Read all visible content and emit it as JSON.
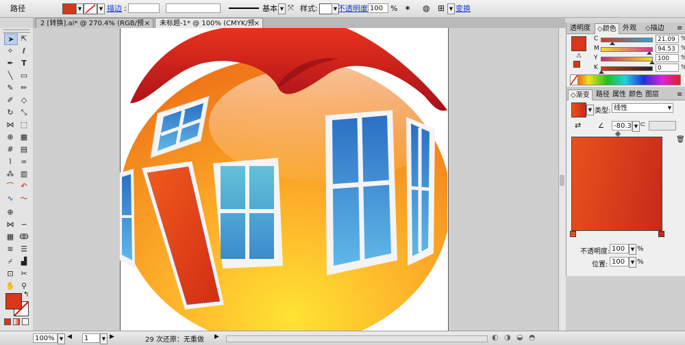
{
  "control_bar": {
    "object_type": "路径",
    "fill_color": "#d9371a",
    "stroke_label": "描边",
    "stroke_weight": "",
    "brush_profile": "基本",
    "style_label": "样式:",
    "opacity_label": "不透明度",
    "opacity_value": "100",
    "opacity_unit": "%",
    "transform_label": "变换"
  },
  "document_tabs": [
    {
      "label": "2 [转换].ai* @ 270.4% (RGB/预览)",
      "close": "×"
    },
    {
      "label": "未标题-1* @ 100% (CMYK/预览)",
      "close": "×"
    }
  ],
  "panels": {
    "top_tabs": [
      "透明度",
      "颜色",
      "外观",
      "描边"
    ],
    "color": {
      "swatch": "#d9371a",
      "channels": [
        {
          "name": "C",
          "value": "21.09",
          "unit": "%",
          "fraction": 0.21,
          "color": "#2aa8d8"
        },
        {
          "name": "M",
          "value": "94.53",
          "unit": "%",
          "fraction": 0.95,
          "color": "#e0309a"
        },
        {
          "name": "Y",
          "value": "100",
          "unit": "%",
          "fraction": 1.0,
          "color": "#f2e018"
        },
        {
          "name": "K",
          "value": "0",
          "unit": "%",
          "fraction": 0.0,
          "color": "#222222"
        }
      ]
    },
    "gradient_tabs": [
      "渐变",
      "路径",
      "属性",
      "颜色",
      "图层"
    ],
    "gradient": {
      "type_label": "类型:",
      "type_value": "线性",
      "angle_value": "-80.3",
      "start_color": "#e8521c",
      "end_color": "#c72a1a",
      "opacity_label": "不透明度:",
      "opacity_value": "100",
      "position_label": "位置:",
      "position_value": "100",
      "unit": "%"
    }
  },
  "status_bar": {
    "zoom": "100%",
    "page": "1",
    "message": "29 次还原：无重做"
  }
}
